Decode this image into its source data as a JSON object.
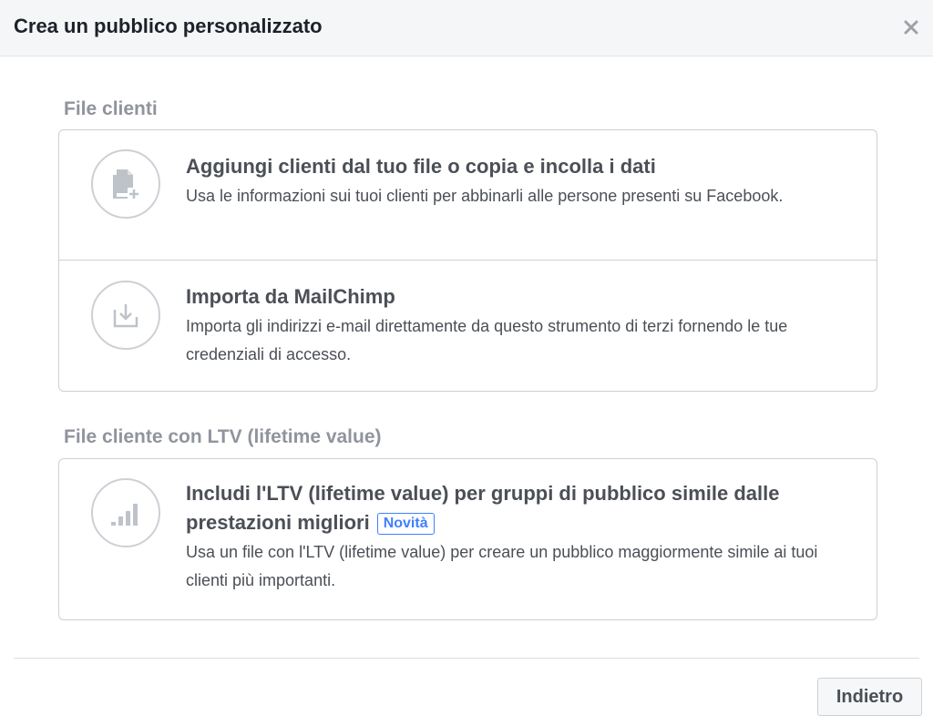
{
  "dialog": {
    "title": "Crea un pubblico personalizzato",
    "close_icon": "close-icon"
  },
  "sections": [
    {
      "title": "File clienti",
      "options": [
        {
          "icon": "file-add-icon",
          "title": "Aggiungi clienti dal tuo file o copia e incolla i dati",
          "description": "Usa le informazioni sui tuoi clienti per abbinarli alle persone presenti su Facebook."
        },
        {
          "icon": "import-icon",
          "title": "Importa da MailChimp",
          "description": "Importa gli indirizzi e-mail direttamente da questo strumento di terzi fornendo le tue credenziali di accesso."
        }
      ]
    },
    {
      "title": "File cliente con LTV (lifetime value)",
      "options": [
        {
          "icon": "bar-chart-icon",
          "title": "Includi l'LTV (lifetime value) per gruppi di pubblico simile dalle prestazioni migliori",
          "badge": "Novità",
          "description": "Usa un file con l'LTV (lifetime value) per creare un pubblico maggiormente simile ai tuoi clienti più importanti."
        }
      ]
    }
  ],
  "footer": {
    "back_label": "Indietro"
  },
  "colors": {
    "header_bg": "#f5f6f7",
    "section_title": "#90949c",
    "text": "#4b4f56",
    "border": "#ccd0d5",
    "badge": "#4080ff"
  }
}
